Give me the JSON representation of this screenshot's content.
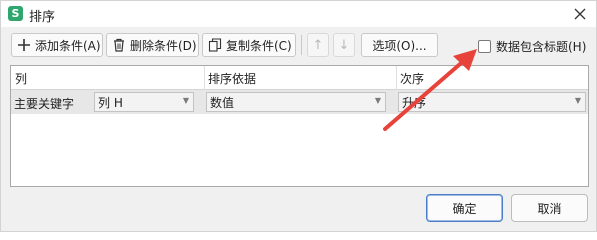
{
  "window": {
    "title": "排序",
    "app_icon_letter": "S"
  },
  "toolbar": {
    "add_label": "添加条件(A)",
    "delete_label": "删除条件(D)",
    "copy_label": "复制条件(C)",
    "move_up_glyph": "↑",
    "move_down_glyph": "↓",
    "options_label": "选项(O)..."
  },
  "header_checkbox": {
    "label": "数据包含标题(H)",
    "checked": false
  },
  "grid": {
    "columns": [
      "列",
      "排序依据",
      "次序"
    ],
    "rows": [
      {
        "label": "主要关键字",
        "column": "列 H",
        "sort_on": "数值",
        "order": "升序"
      }
    ]
  },
  "footer": {
    "ok_label": "确定",
    "cancel_label": "取消"
  },
  "colors": {
    "annotation_arrow": "#e8433a",
    "app_icon": "#2fa66d",
    "primary_border": "#4b7dc6"
  }
}
